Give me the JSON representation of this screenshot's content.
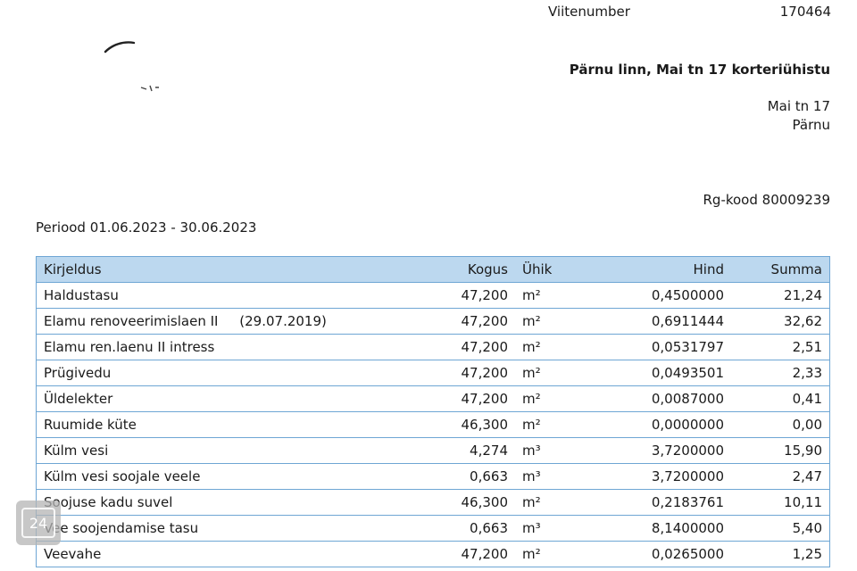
{
  "header": {
    "reference_label": "Viitenumber",
    "reference_value": "170464"
  },
  "logo": {
    "icon": "signature-logo-icon"
  },
  "recipient": {
    "name": "Pärnu linn, Mai tn 17 korteriühistu",
    "street": "Mai tn 17",
    "city": "Pärnu",
    "reg_code": "Rg-kood 80009239"
  },
  "period": "Periood 01.06.2023 - 30.06.2023",
  "table": {
    "headers": {
      "description": "Kirjeldus",
      "quantity": "Kogus",
      "unit": "Ühik",
      "price": "Hind",
      "sum": "Summa"
    },
    "rows": [
      {
        "description": "Haldustasu",
        "quantity": "47,200",
        "unit": "m²",
        "price": "0,4500000",
        "sum": "21,24"
      },
      {
        "description": "Elamu renoveerimislaen II     (29.07.2019)",
        "quantity": "47,200",
        "unit": "m²",
        "price": "0,6911444",
        "sum": "32,62"
      },
      {
        "description": "Elamu ren.laenu II intress",
        "quantity": "47,200",
        "unit": "m²",
        "price": "0,0531797",
        "sum": "2,51"
      },
      {
        "description": "Prügivedu",
        "quantity": "47,200",
        "unit": "m²",
        "price": "0,0493501",
        "sum": "2,33"
      },
      {
        "description": "Üldelekter",
        "quantity": "47,200",
        "unit": "m²",
        "price": "0,0087000",
        "sum": "0,41"
      },
      {
        "description": "Ruumide küte",
        "quantity": "46,300",
        "unit": "m²",
        "price": "0,0000000",
        "sum": "0,00"
      },
      {
        "description": "Külm vesi",
        "quantity": "4,274",
        "unit": "m³",
        "price": "3,7200000",
        "sum": "15,90"
      },
      {
        "description": "Külm vesi soojale veele",
        "quantity": "0,663",
        "unit": "m³",
        "price": "3,7200000",
        "sum": "2,47"
      },
      {
        "description": "Soojuse kadu suvel",
        "quantity": "46,300",
        "unit": "m²",
        "price": "0,2183761",
        "sum": "10,11"
      },
      {
        "description": "Vee soojendamise tasu",
        "quantity": "0,663",
        "unit": "m³",
        "price": "8,1400000",
        "sum": "5,40"
      },
      {
        "description": "Veevahe",
        "quantity": "47,200",
        "unit": "m²",
        "price": "0,0265000",
        "sum": "1,25"
      }
    ]
  },
  "overlay_badge": {
    "label": "24"
  }
}
